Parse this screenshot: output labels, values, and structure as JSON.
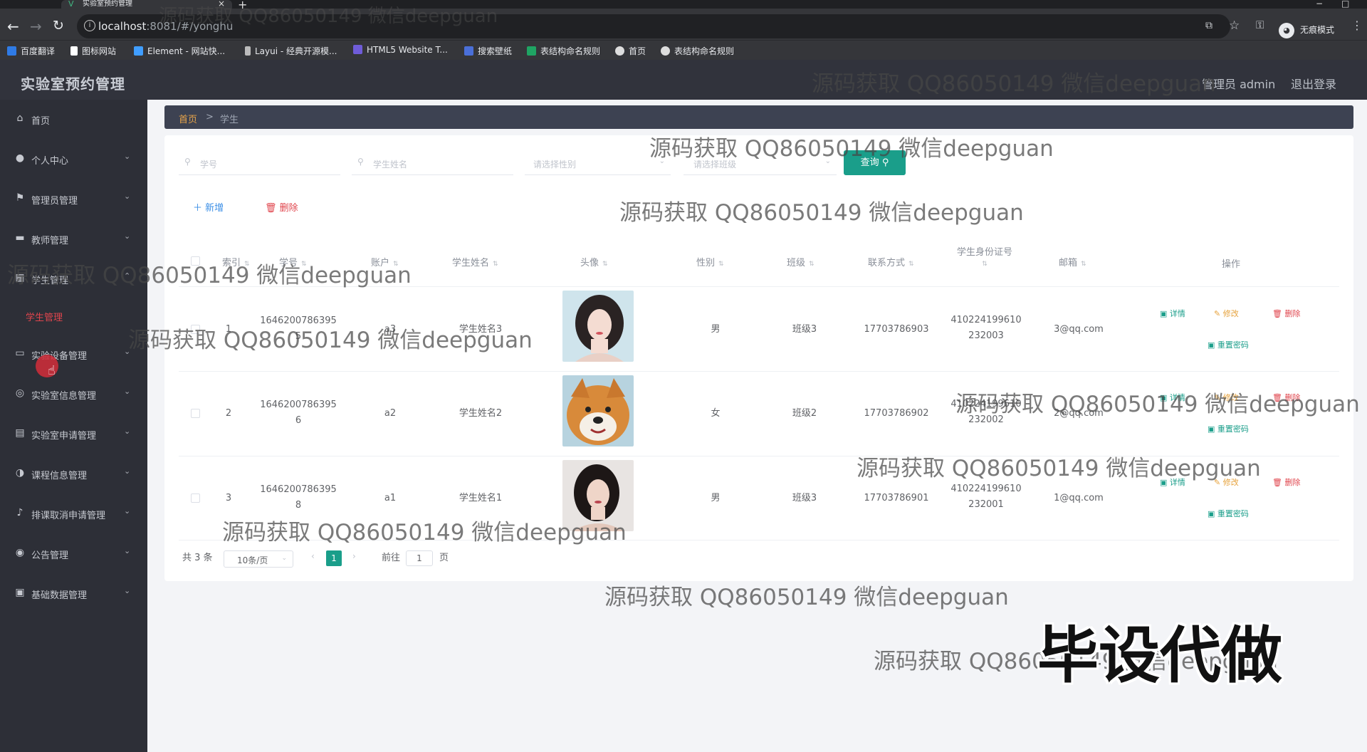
{
  "browser": {
    "tab_title": "实验室预约管理",
    "url_host": "localhost",
    "url_rest": ":8081/#/yonghu",
    "incognito_label": "无痕模式",
    "bookmarks": [
      "百度翻译",
      "图标网站",
      "Element - 网站快...",
      "Layui - 经典开源模...",
      "HTML5 Website T...",
      "搜索壁纸",
      "表结构命名规则",
      "首页",
      "表结构命名规则"
    ]
  },
  "header": {
    "title": "实验室预约管理",
    "admin_label": "管理员 admin",
    "logout_label": "退出登录"
  },
  "sidebar": {
    "items": [
      {
        "label": "首页",
        "icon": "home-icon"
      },
      {
        "label": "个人中心",
        "icon": "user-icon"
      },
      {
        "label": "管理员管理",
        "icon": "flag-icon"
      },
      {
        "label": "教师管理",
        "icon": "briefcase-icon"
      },
      {
        "label": "学生管理",
        "icon": "calendar-icon"
      },
      {
        "label": "实验设备管理",
        "icon": "monitor-icon"
      },
      {
        "label": "实验室信息管理",
        "icon": "globe-icon"
      },
      {
        "label": "实验室申请管理",
        "icon": "document-icon"
      },
      {
        "label": "课程信息管理",
        "icon": "compass-icon"
      },
      {
        "label": "排课取消申请管理",
        "icon": "mic-icon"
      },
      {
        "label": "公告管理",
        "icon": "broadcast-icon"
      },
      {
        "label": "基础数据管理",
        "icon": "clipboard-icon"
      }
    ],
    "active_sub": "学生管理"
  },
  "breadcrumb": {
    "home": "首页",
    "sep": ">",
    "current": "学生"
  },
  "filters": {
    "student_no": "学号",
    "student_name": "学生姓名",
    "gender": "请选择性别",
    "class": "请选择班级",
    "query": "查询"
  },
  "actions": {
    "add": "新增",
    "delete": "删除"
  },
  "table": {
    "headers": [
      "索引",
      "学号",
      "账户",
      "学生姓名",
      "头像",
      "性别",
      "班级",
      "联系方式",
      "学生身份证号",
      "邮箱",
      "操作"
    ],
    "rows": [
      {
        "index": "1",
        "no1": "1646200786395",
        "no2": "5",
        "account": "a3",
        "name": "学生姓名3",
        "gender": "男",
        "class": "班级3",
        "phone": "17703786903",
        "id1": "410224199610",
        "id2": "232003",
        "email": "3@qq.com"
      },
      {
        "index": "2",
        "no1": "1646200786395",
        "no2": "6",
        "account": "a2",
        "name": "学生姓名2",
        "gender": "女",
        "class": "班级2",
        "phone": "17703786902",
        "id1": "410224199610",
        "id2": "232002",
        "email": "2@qq.com"
      },
      {
        "index": "3",
        "no1": "1646200786395",
        "no2": "8",
        "account": "a1",
        "name": "学生姓名1",
        "gender": "男",
        "class": "班级3",
        "phone": "17703786901",
        "id1": "410224199610",
        "id2": "232001",
        "email": "1@qq.com"
      }
    ],
    "ops": {
      "detail": "详情",
      "edit": "修改",
      "remove": "删除",
      "reset": "重置密码"
    }
  },
  "pagination": {
    "total": "共 3 条",
    "size": "10条/页",
    "current": "1",
    "goto": "前往",
    "goto_value": "1",
    "page_unit": "页"
  },
  "overlay": {
    "watermark": "源码获取 QQ86050149 微信deepguan",
    "stamp": "毕设代做"
  },
  "colors": {
    "accent": "#1a9e8a",
    "danger": "#e0454d",
    "warning": "#e6a23c",
    "sidebar": "#2d2f37"
  }
}
